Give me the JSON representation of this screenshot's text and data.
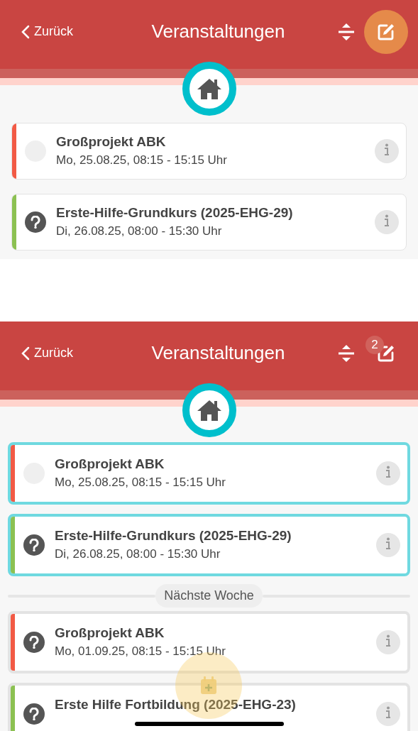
{
  "screens": [
    {
      "header": {
        "back": "Zurück",
        "title": "Veranstaltungen"
      },
      "edit_active": true,
      "selection_mode": false,
      "sections": [
        {
          "events": [
            {
              "title": "Großprojekt ABK",
              "date": "Mo, 25.08.25, 08:15 - 15:15 Uhr",
              "color": "#f25a45",
              "kind": "empty"
            },
            {
              "title": "Erste-Hilfe-Grundkurs (2025-EHG-29)",
              "date": "Di, 26.08.25, 08:00 - 15:30 Uhr",
              "color": "#8cc152",
              "kind": "question"
            }
          ]
        }
      ]
    },
    {
      "header": {
        "back": "Zurück",
        "title": "Veranstaltungen"
      },
      "edit_active": false,
      "selected_count": "2",
      "selection_mode": true,
      "sections": [
        {
          "events": [
            {
              "title": "Großprojekt ABK",
              "date": "Mo, 25.08.25, 08:15 - 15:15 Uhr",
              "color": "#f25a45",
              "kind": "empty",
              "selected": true
            },
            {
              "title": "Erste-Hilfe-Grundkurs (2025-EHG-29)",
              "date": "Di, 26.08.25, 08:00 - 15:30 Uhr",
              "color": "#8cc152",
              "kind": "question",
              "selected": true
            }
          ]
        },
        {
          "label": "Nächste Woche",
          "events": [
            {
              "title": "Großprojekt ABK",
              "date": "Mo, 01.09.25, 08:15 - 15:15 Uhr",
              "color": "#f25a45",
              "kind": "question",
              "selected": false
            },
            {
              "title": "Erste Hilfe Fortbildung (2025-EHG-23)",
              "color": "#8cc152",
              "kind": "question",
              "selected": false
            }
          ]
        }
      ]
    }
  ]
}
